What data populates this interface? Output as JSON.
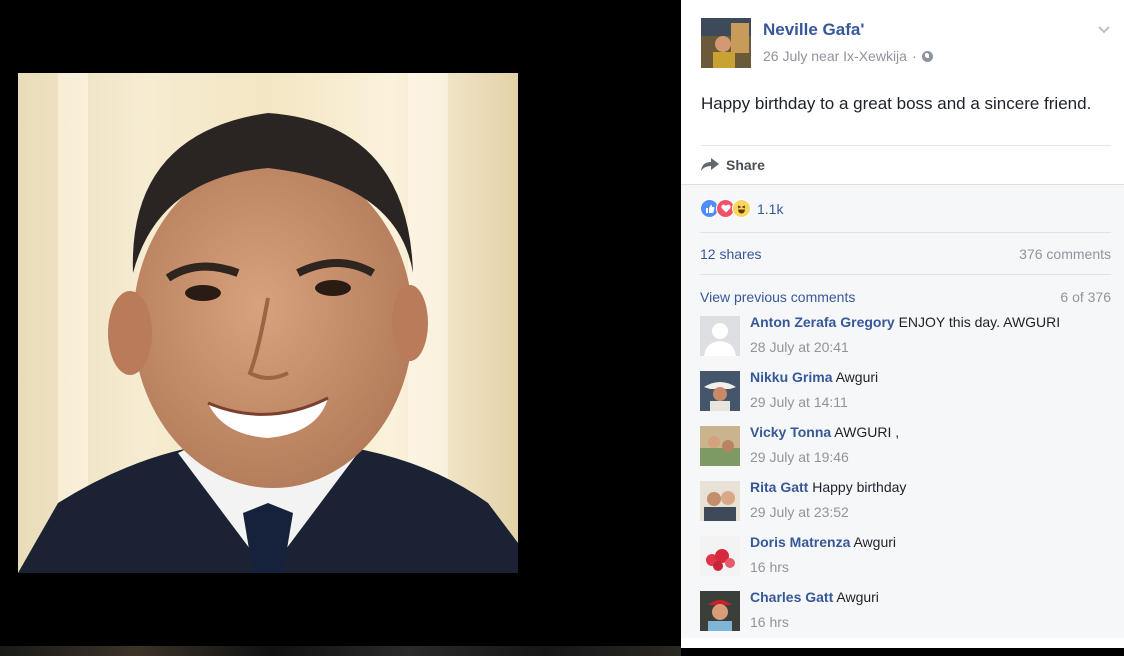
{
  "post": {
    "author": "Neville Gafa'",
    "date": "26 July near Ix-Xewkija",
    "separator": "·",
    "text": "Happy birthday to a great boss and a sincere friend.",
    "share_label": "Share"
  },
  "feedback": {
    "reaction_count": "1.1k",
    "reactions": [
      "like-icon",
      "love-icon",
      "haha-icon"
    ],
    "shares": "12 shares",
    "comments_total": "376 comments",
    "view_previous": "View previous comments",
    "page_count": "6 of 376"
  },
  "comments": [
    {
      "name": "Anton Zerafa Gregory",
      "text": " ENJOY this day. AWGURI",
      "time": "28 July at 20:41"
    },
    {
      "name": "Nikku Grima",
      "text": " Awguri",
      "time": "29 July at 14:11"
    },
    {
      "name": "Vicky Tonna",
      "text": " AWGURI ,",
      "time": "29 July at 19:46"
    },
    {
      "name": "Rita Gatt",
      "text": " Happy birthday",
      "time": "29 July at 23:52"
    },
    {
      "name": "Doris Matrenza",
      "text": " Awguri",
      "time": "16 hrs"
    },
    {
      "name": "Charles Gatt",
      "text": " Awguri",
      "time": "16 hrs"
    }
  ],
  "colors": {
    "link": "#365899",
    "meta": "#90949c",
    "text": "#1d2129",
    "feedback_bg": "#f6f7f9",
    "like": "#4e8df5",
    "love": "#f25268",
    "haha": "#fdd45e"
  }
}
